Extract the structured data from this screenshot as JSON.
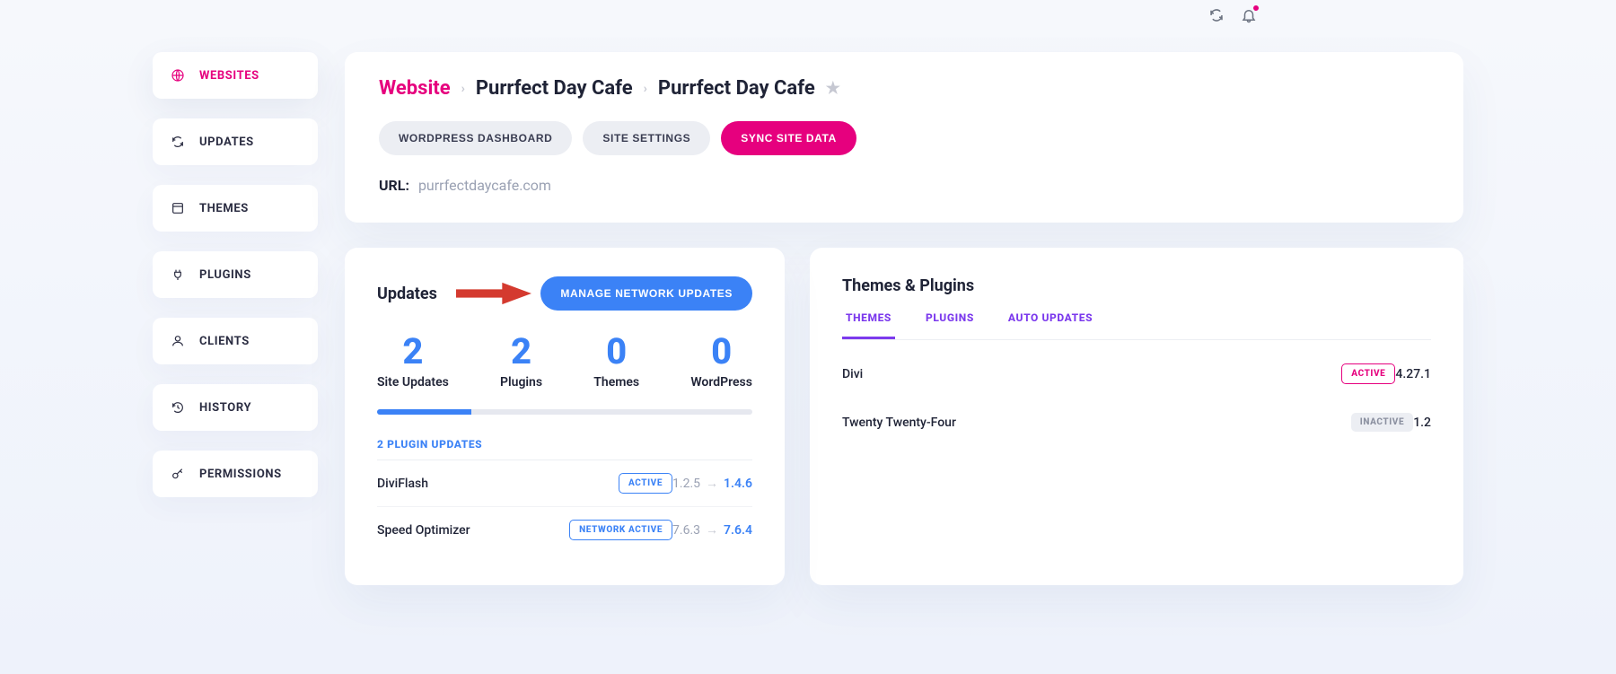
{
  "sidebar": {
    "items": [
      {
        "label": "WEBSITES"
      },
      {
        "label": "UPDATES"
      },
      {
        "label": "THEMES"
      },
      {
        "label": "PLUGINS"
      },
      {
        "label": "CLIENTS"
      },
      {
        "label": "HISTORY"
      },
      {
        "label": "PERMISSIONS"
      }
    ]
  },
  "breadcrumb": {
    "root": "Website",
    "mid": "Purrfect Day Cafe",
    "last": "Purrfect Day Cafe"
  },
  "header_buttons": {
    "wp_dashboard": "WORDPRESS DASHBOARD",
    "site_settings": "SITE SETTINGS",
    "sync": "SYNC SITE DATA"
  },
  "url": {
    "label": "URL:",
    "value": "purrfectdaycafe.com"
  },
  "updates_panel": {
    "title": "Updates",
    "manage_btn": "MANAGE NETWORK UPDATES",
    "stats": [
      {
        "num": "2",
        "label": "Site Updates"
      },
      {
        "num": "2",
        "label": "Plugins"
      },
      {
        "num": "0",
        "label": "Themes"
      },
      {
        "num": "0",
        "label": "WordPress"
      }
    ],
    "subheader": "2 PLUGIN UPDATES",
    "rows": [
      {
        "name": "DiviFlash",
        "badge": "ACTIVE",
        "old": "1.2.5",
        "new": "1.4.6",
        "badge_style": "blue"
      },
      {
        "name": "Speed Optimizer",
        "badge": "NETWORK ACTIVE",
        "old": "7.6.3",
        "new": "7.6.4",
        "badge_style": "blue"
      }
    ]
  },
  "themes_panel": {
    "title": "Themes & Plugins",
    "tabs": [
      {
        "label": "THEMES",
        "active": true
      },
      {
        "label": "PLUGINS",
        "active": false
      },
      {
        "label": "AUTO UPDATES",
        "active": false
      }
    ],
    "rows": [
      {
        "name": "Divi",
        "badge": "ACTIVE",
        "version": "4.27.1",
        "badge_style": "pink"
      },
      {
        "name": "Twenty Twenty-Four",
        "badge": "INACTIVE",
        "version": "1.2",
        "badge_style": "grey"
      }
    ]
  }
}
